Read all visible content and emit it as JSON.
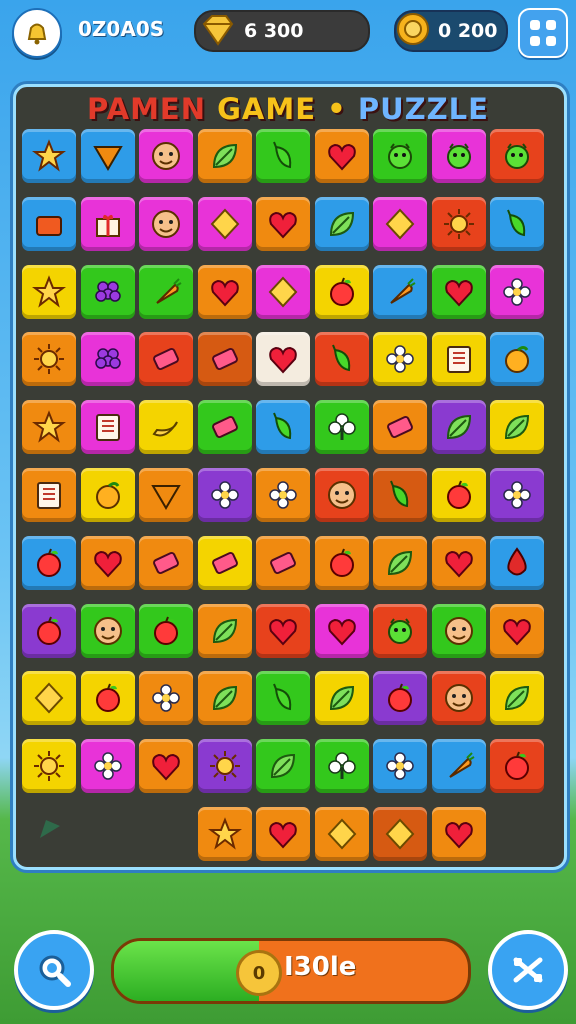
{
  "header": {
    "score_label": "0Z0A0S",
    "gems_label": "6 300",
    "coins_label": "0 200"
  },
  "board": {
    "title_parts": [
      "PAMEN",
      "GAME",
      "•",
      "PUZZLE"
    ],
    "tile_palette": {
      "Y": "#f4d400",
      "O": "#f08a10",
      "R": "#e7421c",
      "G": "#33c81c",
      "P": "#e833d8",
      "B": "#2e9ce8",
      "V": "#8a3ad0",
      "W": "#f4ecdf",
      "M": "#d65a12"
    },
    "rows": [
      [
        [
          "B",
          "star"
        ],
        [
          "B",
          "triangle"
        ],
        [
          "P",
          "face"
        ],
        [
          "O",
          "leaf"
        ],
        [
          "G",
          "pepper"
        ],
        [
          "O",
          "heart"
        ],
        [
          "G",
          "monster"
        ],
        [
          "P",
          "monster"
        ],
        [
          "R",
          "monster"
        ]
      ],
      [
        [
          "B",
          "box"
        ],
        [
          "P",
          "gift"
        ],
        [
          "P",
          "face"
        ],
        [
          "P",
          "diamond"
        ],
        [
          "O",
          "heart"
        ],
        [
          "B",
          "leaf"
        ],
        [
          "P",
          "diamond"
        ],
        [
          "R",
          "sun"
        ],
        [
          "B",
          "pepper"
        ]
      ],
      [
        [
          "Y",
          "star"
        ],
        [
          "G",
          "grapes"
        ],
        [
          "G",
          "carrot"
        ],
        [
          "O",
          "heart"
        ],
        [
          "P",
          "diamond"
        ],
        [
          "Y",
          "apple"
        ],
        [
          "B",
          "carrot"
        ],
        [
          "G",
          "heart"
        ],
        [
          "P",
          "flower"
        ]
      ],
      [
        [
          "O",
          "sun"
        ],
        [
          "P",
          "grapes"
        ],
        [
          "R",
          "candy"
        ],
        [
          "M",
          "candy"
        ],
        [
          "W",
          "heart"
        ],
        [
          "R",
          "pepper"
        ],
        [
          "Y",
          "flower"
        ],
        [
          "Y",
          "book"
        ],
        [
          "B",
          "orange"
        ]
      ],
      [
        [
          "O",
          "star"
        ],
        [
          "P",
          "book"
        ],
        [
          "Y",
          "banana"
        ],
        [
          "G",
          "candy"
        ],
        [
          "B",
          "pepper"
        ],
        [
          "G",
          "club"
        ],
        [
          "O",
          "candy"
        ],
        [
          "V",
          "leaf"
        ],
        [
          "Y",
          "leaf"
        ]
      ],
      [
        [
          "O",
          "book"
        ],
        [
          "Y",
          "orange"
        ],
        [
          "O",
          "triangle"
        ],
        [
          "V",
          "flower"
        ],
        [
          "O",
          "flower"
        ],
        [
          "R",
          "face"
        ],
        [
          "M",
          "pepper"
        ],
        [
          "Y",
          "apple"
        ],
        [
          "V",
          "flower"
        ]
      ],
      [
        [
          "B",
          "apple"
        ],
        [
          "O",
          "heart"
        ],
        [
          "O",
          "candy"
        ],
        [
          "Y",
          "candy"
        ],
        [
          "O",
          "candy"
        ],
        [
          "O",
          "apple"
        ],
        [
          "O",
          "leaf"
        ],
        [
          "O",
          "heart"
        ],
        [
          "B",
          "drop"
        ]
      ],
      [
        [
          "V",
          "apple"
        ],
        [
          "G",
          "face"
        ],
        [
          "G",
          "apple"
        ],
        [
          "O",
          "leaf"
        ],
        [
          "R",
          "heart"
        ],
        [
          "P",
          "heart"
        ],
        [
          "R",
          "monster"
        ],
        [
          "G",
          "face"
        ],
        [
          "O",
          "heart"
        ]
      ],
      [
        [
          "Y",
          "diamond"
        ],
        [
          "Y",
          "apple"
        ],
        [
          "O",
          "flower"
        ],
        [
          "O",
          "leaf"
        ],
        [
          "G",
          "pepper"
        ],
        [
          "Y",
          "leaf"
        ],
        [
          "V",
          "apple"
        ],
        [
          "R",
          "face"
        ],
        [
          "Y",
          "leaf"
        ]
      ],
      [
        [
          "Y",
          "sun"
        ],
        [
          "P",
          "flower"
        ],
        [
          "O",
          "heart"
        ],
        [
          "V",
          "sun"
        ],
        [
          "G",
          "leaf"
        ],
        [
          "G",
          "club"
        ],
        [
          "B",
          "flower"
        ],
        [
          "B",
          "carrot"
        ],
        [
          "R",
          "apple"
        ]
      ],
      [
        null,
        null,
        null,
        [
          "O",
          "star"
        ],
        [
          "O",
          "heart"
        ],
        [
          "O",
          "diamond"
        ],
        [
          "M",
          "diamond"
        ],
        [
          "O",
          "heart"
        ],
        null
      ]
    ]
  },
  "footer": {
    "progress_label": "I30le",
    "coin_symbol": "0",
    "progress_fraction": 0.41
  }
}
